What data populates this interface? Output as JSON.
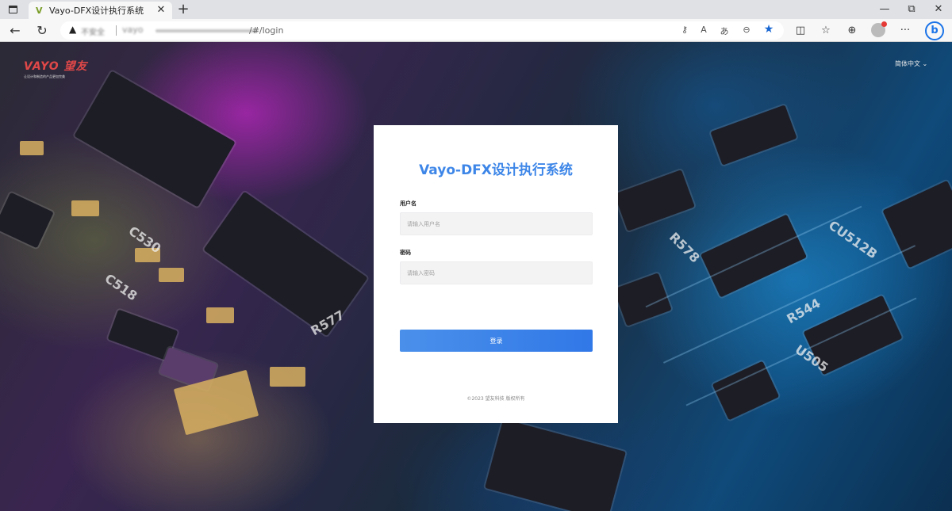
{
  "browser": {
    "tab_title": "Vayo-DFX设计执行系统",
    "tab_favicon": "V",
    "tab_close": "✕",
    "new_tab": "+",
    "window_controls": {
      "minimize": "—",
      "restore": "⧉",
      "close": "✕"
    },
    "nav": {
      "back": "←",
      "refresh": "↻"
    },
    "address": {
      "warning_icon": "▲",
      "not_secure_label": "不安全",
      "host": "vayo",
      "path": "/#/login"
    },
    "toolbar_glyphs": {
      "key": "⚷",
      "read_aloud": "A",
      "translate": "あ",
      "zoom": "⊖",
      "favorite": "★",
      "split": "◫",
      "favorites": "☆",
      "collections": "⊕",
      "more": "···",
      "bing": "b"
    },
    "icons": [
      "sidebar-icon",
      "favicon-vayo-icon",
      "close-icon",
      "plus-icon",
      "minimize-icon",
      "restore-icon",
      "back-arrow-icon",
      "refresh-icon",
      "warning-icon",
      "key-icon",
      "read-aloud-icon",
      "translate-icon",
      "zoom-out-icon",
      "star-icon",
      "split-screen-icon",
      "favorites-icon",
      "collections-icon",
      "profile-icon",
      "more-icon",
      "bing-icon"
    ]
  },
  "page": {
    "logo_text": "VAYO",
    "logo_cn": "望友",
    "logo_tagline": "让设计和制造的产品更加完美",
    "language_selector": "简体中文 ⌄"
  },
  "login": {
    "title": "Vayo-DFX设计执行系统",
    "username_label": "用户名",
    "username_placeholder": "请输入用户名",
    "password_label": "密码",
    "password_placeholder": "请输入密码",
    "submit_label": "登录",
    "copyright": "©2023 望友科技 版权所有"
  },
  "colors": {
    "accent": "#3d86e8",
    "button": "#3178e8",
    "tabbar": "#dfe1e5"
  }
}
